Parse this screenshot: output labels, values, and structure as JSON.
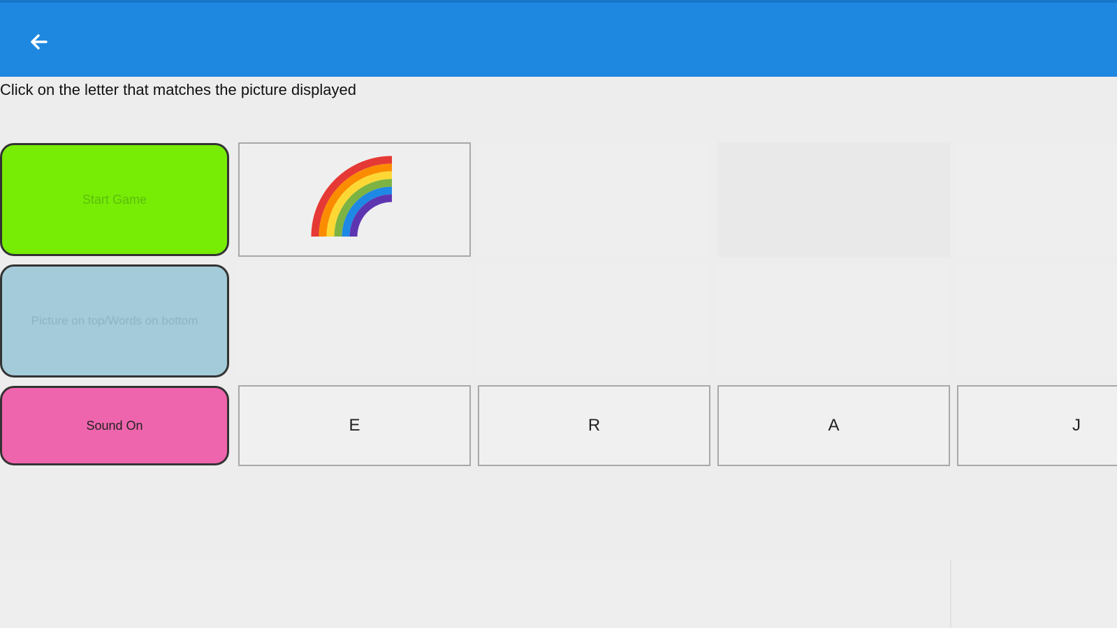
{
  "header": {
    "back_icon": "arrow-left-icon",
    "color": "#1e88e0"
  },
  "instruction": "Click on the letter that matches the picture displayed",
  "controls": {
    "start": "Start Game",
    "mode": "Picture on top/Words on bottom",
    "sound": "Sound On"
  },
  "picture": {
    "icon": "rainbow-icon"
  },
  "letters": [
    "E",
    "R",
    "A",
    "J"
  ],
  "colors": {
    "start": "#77ec05",
    "mode": "#a3cbd9",
    "sound": "#ef65ad"
  }
}
